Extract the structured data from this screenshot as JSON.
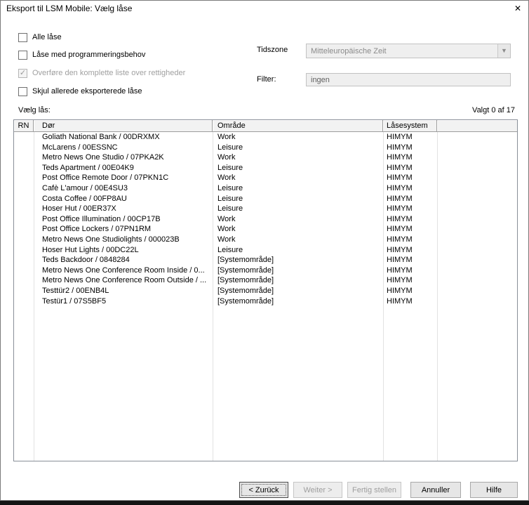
{
  "window": {
    "title": "Eksport til LSM Mobile: Vælg låse",
    "close_glyph": "✕"
  },
  "icons": {
    "dropdown_arrow": "▼"
  },
  "options": {
    "checkboxes": [
      {
        "label": "Alle låse",
        "checked": false,
        "disabled": false
      },
      {
        "label": "Låse med programmeringsbehov",
        "checked": false,
        "disabled": false
      },
      {
        "label": "Overføre den komplette liste over rettigheder",
        "checked": true,
        "disabled": true
      },
      {
        "label": "Skjul allerede eksporterede låse",
        "checked": false,
        "disabled": false
      }
    ],
    "tidszone_label": "Tidszone",
    "tidszone_value": "Mitteleuropäische Zeit",
    "filter_label": "Filter:",
    "filter_value": "ingen"
  },
  "list": {
    "caption": "Vælg lås:",
    "selection_status": "Valgt 0 af 17",
    "columns": [
      "RN",
      "Dør",
      "Område",
      "Låsesystem",
      ""
    ],
    "rows": [
      {
        "rn": "",
        "door": "Goliath National Bank / 00DRXMX",
        "area": "Work",
        "system": "HIMYM"
      },
      {
        "rn": "",
        "door": "McLarens / 00ESSNC",
        "area": "Leisure",
        "system": "HIMYM"
      },
      {
        "rn": "",
        "door": "Metro News One Studio / 07PKA2K",
        "area": "Work",
        "system": "HIMYM"
      },
      {
        "rn": "",
        "door": "Teds Apartment / 00E04K9",
        "area": "Leisure",
        "system": "HIMYM"
      },
      {
        "rn": "",
        "door": "Post Office Remote Door / 07PKN1C",
        "area": "Work",
        "system": "HIMYM"
      },
      {
        "rn": "",
        "door": "Cafè L'amour / 00E4SU3",
        "area": "Leisure",
        "system": "HIMYM"
      },
      {
        "rn": "",
        "door": "Costa Coffee / 00FP8AU",
        "area": "Leisure",
        "system": "HIMYM"
      },
      {
        "rn": "",
        "door": "Hoser Hut / 00ER37X",
        "area": "Leisure",
        "system": "HIMYM"
      },
      {
        "rn": "",
        "door": "Post Office Illumination / 00CP17B",
        "area": "Work",
        "system": "HIMYM"
      },
      {
        "rn": "",
        "door": "Post Office Lockers / 07PN1RM",
        "area": "Work",
        "system": "HIMYM"
      },
      {
        "rn": "",
        "door": "Metro News One Studiolights / 000023B",
        "area": "Work",
        "system": "HIMYM"
      },
      {
        "rn": "",
        "door": "Hoser Hut Lights / 00DC22L",
        "area": "Leisure",
        "system": "HIMYM"
      },
      {
        "rn": "",
        "door": "Teds Backdoor / 0848284",
        "area": "[Systemområde]",
        "system": "HIMYM"
      },
      {
        "rn": "",
        "door": "Metro News One Conference Room Inside / 0...",
        "area": "[Systemområde]",
        "system": "HIMYM"
      },
      {
        "rn": "",
        "door": "Metro News One Conference Room Outside / ...",
        "area": "[Systemområde]",
        "system": "HIMYM"
      },
      {
        "rn": "",
        "door": "Testtür2 / 00ENB4L",
        "area": "[Systemområde]",
        "system": "HIMYM"
      },
      {
        "rn": "",
        "door": "Testür1 / 07S5BF5",
        "area": "[Systemområde]",
        "system": "HIMYM"
      }
    ]
  },
  "footer": {
    "buttons": [
      {
        "label": "< Zurück",
        "enabled": true,
        "focused": true
      },
      {
        "label": "Weiter >",
        "enabled": false,
        "focused": false
      },
      {
        "label": "Fertig stellen",
        "enabled": false,
        "focused": false
      },
      {
        "label": "Annuller",
        "enabled": true,
        "focused": false
      },
      {
        "label": "Hilfe",
        "enabled": true,
        "focused": false
      }
    ]
  }
}
